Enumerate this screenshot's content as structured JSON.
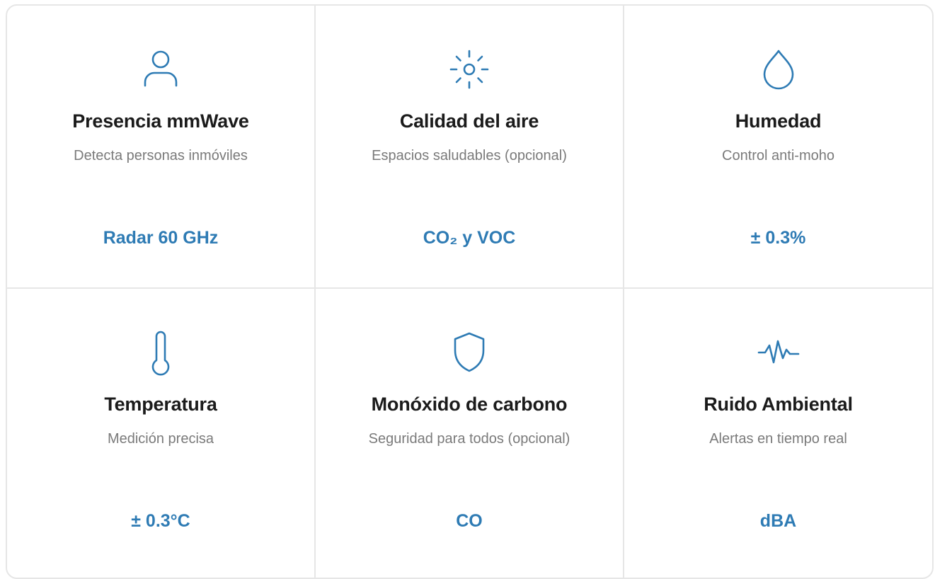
{
  "accent_color": "#2e7bb4",
  "features": [
    {
      "icon": "user-icon",
      "title": "Presencia mmWave",
      "subtitle": "Detecta personas inmóviles",
      "spec": "Radar 60 GHz"
    },
    {
      "icon": "sun-icon",
      "title": "Calidad del aire",
      "subtitle": "Espacios saludables (opcional)",
      "spec": "CO₂ y VOC"
    },
    {
      "icon": "droplet-icon",
      "title": "Humedad",
      "subtitle": "Control anti-moho",
      "spec": "± 0.3%"
    },
    {
      "icon": "thermometer-icon",
      "title": "Temperatura",
      "subtitle": "Medición precisa",
      "spec": "± 0.3°C"
    },
    {
      "icon": "shield-icon",
      "title": "Monóxido de carbono",
      "subtitle": "Seguridad para todos (opcional)",
      "spec": "CO"
    },
    {
      "icon": "activity-icon",
      "title": "Ruido Ambiental",
      "subtitle": "Alertas en tiempo real",
      "spec": "dBA"
    }
  ]
}
